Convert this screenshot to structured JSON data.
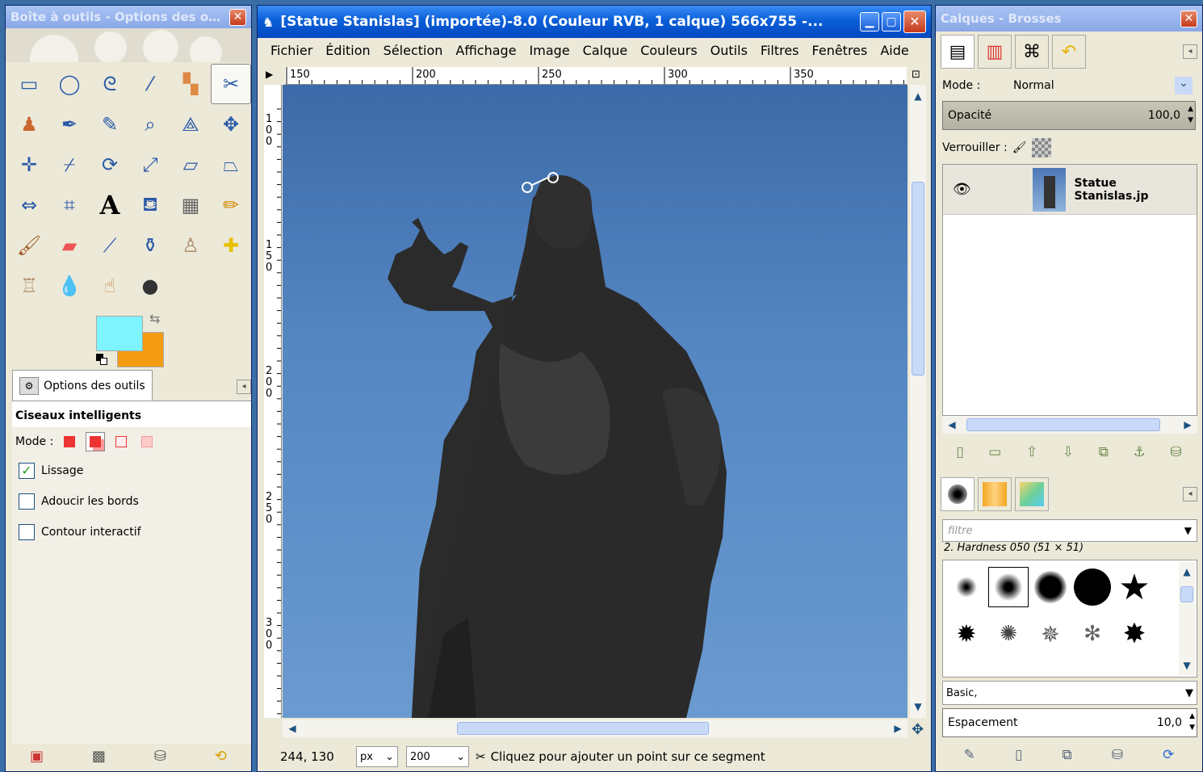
{
  "toolbox": {
    "title": "Boîte à outils - Options des ou...",
    "tools": [
      "rect-select",
      "ellipse-select",
      "free-select",
      "fuzzy-select",
      "select-by-color",
      "scissors",
      "foreground-select",
      "paths",
      "color-picker",
      "zoom",
      "measure",
      "move",
      "align",
      "crop",
      "rotate",
      "scale",
      "shear",
      "perspective",
      "flip",
      "cage",
      "text",
      "bucket-fill",
      "blend",
      "pencil",
      "paintbrush",
      "eraser",
      "airbrush",
      "ink",
      "clone",
      "heal",
      "perspective-clone",
      "blur",
      "smudge",
      "dodge-burn"
    ],
    "colors": {
      "fg": "#7df4ff",
      "bg": "#f39c12"
    },
    "options_tab": "Options des outils",
    "tool_name": "Ciseaux intelligents",
    "mode_label": "Mode :",
    "checkboxes": [
      {
        "label": "Lissage",
        "checked": true
      },
      {
        "label": "Adoucir les bords",
        "checked": false
      },
      {
        "label": "Contour interactif",
        "checked": false
      }
    ]
  },
  "image_window": {
    "title": "[Statue Stanislas] (importée)-8.0 (Couleur RVB, 1 calque) 566x755 -...",
    "menu": [
      "Fichier",
      "Édition",
      "Sélection",
      "Affichage",
      "Image",
      "Calque",
      "Couleurs",
      "Outils",
      "Filtres",
      "Fenêtres",
      "Aide"
    ],
    "ruler_h": [
      "150",
      "200",
      "250",
      "300",
      "350"
    ],
    "ruler_v": [
      "100",
      "150",
      "200",
      "250",
      "300"
    ],
    "coords": "244, 130",
    "unit": "px",
    "zoom": "200",
    "status": "Cliquez pour ajouter un point sur ce segment"
  },
  "dock": {
    "title": "Calques - Brosses",
    "mode_label": "Mode :",
    "mode_value": "Normal",
    "opacity_label": "Opacité",
    "opacity_value": "100,0",
    "lock_label": "Verrouiller :",
    "layer_name": "Statue Stanislas.jp",
    "filter_placeholder": "filtre",
    "brush_name": "2. Hardness 050 (51 × 51)",
    "brush_set": "Basic,",
    "spacing_label": "Espacement",
    "spacing_value": "10,0"
  }
}
